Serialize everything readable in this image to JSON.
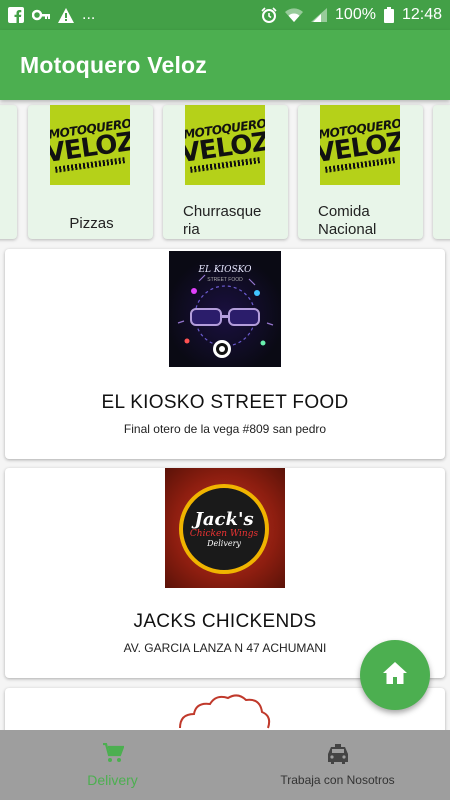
{
  "status_bar": {
    "battery": "100%",
    "time": "12:48",
    "ellipsis": "...",
    "icons_left": [
      "facebook-icon",
      "key-icon",
      "warning-icon"
    ],
    "icons_right": [
      "alarm-icon",
      "wifi-icon",
      "signal-icon",
      "battery-icon"
    ]
  },
  "app_bar": {
    "title": "Motoquero Veloz"
  },
  "logo": {
    "top": "MOTOQUERO",
    "bottom": "VELOZ"
  },
  "categories": [
    {
      "label": "Pizzas"
    },
    {
      "label": "Churrasqueria"
    },
    {
      "label": "Comida Nacional"
    }
  ],
  "restaurants": [
    {
      "name": "EL KIOSKO STREET FOOD",
      "address": "Final otero de la vega #809 san pedro",
      "image_title": "EL KIOSKO",
      "image_sub": "STREET FOOD"
    },
    {
      "name": "JACKS CHICKENDS",
      "address": "AV. GARCIA LANZA N 47 ACHUMANI",
      "image_title": "Jack's",
      "image_sub": "Chicken Wings",
      "image_sub2": "Delivery"
    }
  ],
  "fab": {
    "icon": "home-icon"
  },
  "bottom_nav": [
    {
      "label": "Delivery",
      "icon": "cart-icon",
      "active": true
    },
    {
      "label": "Trabaja con Nosotros",
      "icon": "taxi-icon",
      "active": false
    }
  ],
  "colors": {
    "primary": "#4caf50",
    "status": "#43a047",
    "category_bg": "#e8f5e9",
    "logo_bg": "#b5d119",
    "nav_bg": "#9e9e9e"
  }
}
